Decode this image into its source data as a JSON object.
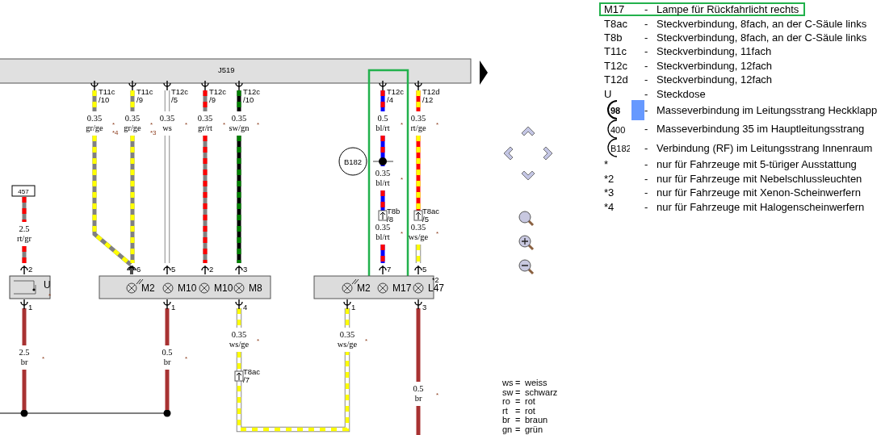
{
  "diagram": {
    "control_unit": "J519",
    "wires": [
      {
        "highlighted": false,
        "connector": {
          "name": "T11c",
          "pin": "/10"
        },
        "labels": [
          {
            "size": "0.35",
            "code": "gr/ge",
            "notes": [
              "*",
              "*4"
            ]
          }
        ]
      },
      {
        "highlighted": false,
        "connector": {
          "name": "T11c",
          "pin": "/9"
        },
        "labels": [
          {
            "size": "0.35",
            "code": "gr/ge",
            "notes": [
              "*",
              "*3"
            ]
          }
        ],
        "end_pin": "6"
      },
      {
        "highlighted": false,
        "connector": {
          "name": "T12c",
          "pin": "/5"
        },
        "labels": [
          {
            "size": "0.35",
            "code": "ws",
            "notes": [
              "*"
            ]
          }
        ],
        "end_pin": "5"
      },
      {
        "highlighted": false,
        "connector": {
          "name": "T12c",
          "pin": "/9"
        },
        "labels": [
          {
            "size": "0.35",
            "code": "gr/rt",
            "notes": [
              "*"
            ]
          }
        ],
        "end_pin": "2"
      },
      {
        "highlighted": false,
        "connector": {
          "name": "T12c",
          "pin": "/10"
        },
        "labels": [
          {
            "size": "0.35",
            "code": "sw/gn",
            "notes": [
              "*"
            ]
          }
        ],
        "end_pin": "3"
      },
      {
        "highlighted": true,
        "connector": {
          "name": "T12c",
          "pin": "/4"
        },
        "labels": [
          {
            "size": "0.5",
            "code": "bl/rt",
            "notes": [
              "*"
            ]
          },
          {
            "size": "0.35",
            "code": "bl/rt",
            "notes": [
              "*"
            ]
          },
          {
            "size": "0.35",
            "code": "bl/rt",
            "notes": [
              "*"
            ]
          }
        ],
        "splice": "B182",
        "inline": {
          "name": "T8b",
          "pin": "/8"
        },
        "end_pin": "7"
      },
      {
        "highlighted": false,
        "connector": {
          "name": "T12d",
          "pin": "/12"
        },
        "labels": [
          {
            "size": "0.35",
            "code": "rt/ge",
            "notes": [
              "*"
            ]
          },
          {
            "size": "0.35",
            "code": "ws/ge",
            "notes": [
              "*"
            ]
          }
        ],
        "inline": {
          "name": "T8ac",
          "pin": "/5"
        },
        "end_pin": "5"
      }
    ],
    "socket": {
      "name": "U",
      "note": "*",
      "tag": "457",
      "pin": "2",
      "label": {
        "size": "2.5",
        "code": "rt/gr"
      }
    },
    "modules": [
      {
        "lamps": [
          {
            "kind": "led",
            "name": "M2"
          },
          {
            "kind": "lamp",
            "name": "M10"
          },
          {
            "kind": "lamp",
            "name": "M10"
          },
          {
            "kind": "lamp",
            "name": "M8"
          }
        ]
      },
      {
        "lamps": [
          {
            "kind": "led",
            "name": "M2"
          },
          {
            "kind": "lamp",
            "name": "M17"
          },
          {
            "kind": "lamp",
            "name": "L47",
            "note": "*2"
          }
        ]
      }
    ],
    "returns": [
      {
        "pin": "1",
        "label": {
          "size": "2.5",
          "code": "br",
          "notes": [
            "*"
          ]
        }
      },
      {
        "pin": "1",
        "label": {
          "size": "0.5",
          "code": "br",
          "notes": [
            "*"
          ]
        }
      },
      {
        "pin": "4",
        "label": {
          "size": "0.35",
          "code": "ws/ge",
          "notes": [
            "*"
          ]
        },
        "inline": {
          "name": "T8ac",
          "pin": "/7"
        }
      },
      {
        "pin": "1",
        "label": {
          "size": "0.35",
          "code": "ws/ge",
          "notes": [
            "*"
          ]
        }
      },
      {
        "pin": "3",
        "label": {
          "size": "0.5",
          "code": "br",
          "notes": [
            "*"
          ]
        }
      }
    ]
  },
  "legend": {
    "entries": [
      {
        "kind": "text",
        "code": "M17",
        "dash": "-",
        "description": "Lampe für Rückfahrlicht rechts",
        "highlighted": true,
        "selected": false
      },
      {
        "kind": "text",
        "code": "T8ac",
        "dash": "-",
        "description": "Steckverbindung, 8fach, an der C-Säule links",
        "highlighted": false,
        "selected": false
      },
      {
        "kind": "text",
        "code": "T8b",
        "dash": "-",
        "description": "Steckverbindung, 8fach, an der C-Säule links",
        "highlighted": false,
        "selected": false
      },
      {
        "kind": "text",
        "code": "T11c",
        "dash": "-",
        "description": "Steckverbindung, 11fach",
        "highlighted": false,
        "selected": false
      },
      {
        "kind": "text",
        "code": "T12c",
        "dash": "-",
        "description": "Steckverbindung, 12fach",
        "highlighted": false,
        "selected": false
      },
      {
        "kind": "text",
        "code": "T12d",
        "dash": "-",
        "description": "Steckverbindung, 12fach",
        "highlighted": false,
        "selected": false
      },
      {
        "kind": "text",
        "code": "U",
        "dash": "-",
        "description": "Steckdose",
        "highlighted": false,
        "selected": false
      },
      {
        "kind": "symbol",
        "code": "98",
        "dash": "-",
        "description": "Masseverbindung im Leitungsstrang Heckklapp",
        "highlighted": false,
        "selected": true
      },
      {
        "kind": "symbol",
        "code": "400",
        "dash": "-",
        "description": "Masseverbindung 35 im Hauptleitungsstrang",
        "highlighted": false,
        "selected": false
      },
      {
        "kind": "symbol",
        "code": "B182",
        "dash": "-",
        "description": "Verbindung (RF) im Leitungsstrang Innenraum",
        "highlighted": false,
        "selected": false
      },
      {
        "kind": "text",
        "code": "*",
        "dash": "-",
        "description": "nur für Fahrzeuge mit 5-türiger Ausstattung",
        "highlighted": false,
        "selected": false
      },
      {
        "kind": "text",
        "code": "*2",
        "dash": "-",
        "description": "nur für Fahrzeuge mit Nebelschlussleuchten",
        "highlighted": false,
        "selected": false
      },
      {
        "kind": "text",
        "code": "*3",
        "dash": "-",
        "description": "nur für Fahrzeuge mit Xenon-Scheinwerfern",
        "highlighted": false,
        "selected": false
      },
      {
        "kind": "text",
        "code": "*4",
        "dash": "-",
        "description": "nur für Fahrzeuge mit Halogenscheinwerfern",
        "highlighted": false,
        "selected": false
      }
    ]
  },
  "color_key": [
    {
      "code": "ws",
      "eq": "=",
      "name": "weiss"
    },
    {
      "code": "sw",
      "eq": "=",
      "name": "schwarz"
    },
    {
      "code": "ro",
      "eq": "=",
      "name": "rot"
    },
    {
      "code": "rt",
      "eq": "=",
      "name": "rot"
    },
    {
      "code": "br",
      "eq": "=",
      "name": "braun"
    },
    {
      "code": "gn",
      "eq": "=",
      "name": "grün"
    }
  ]
}
